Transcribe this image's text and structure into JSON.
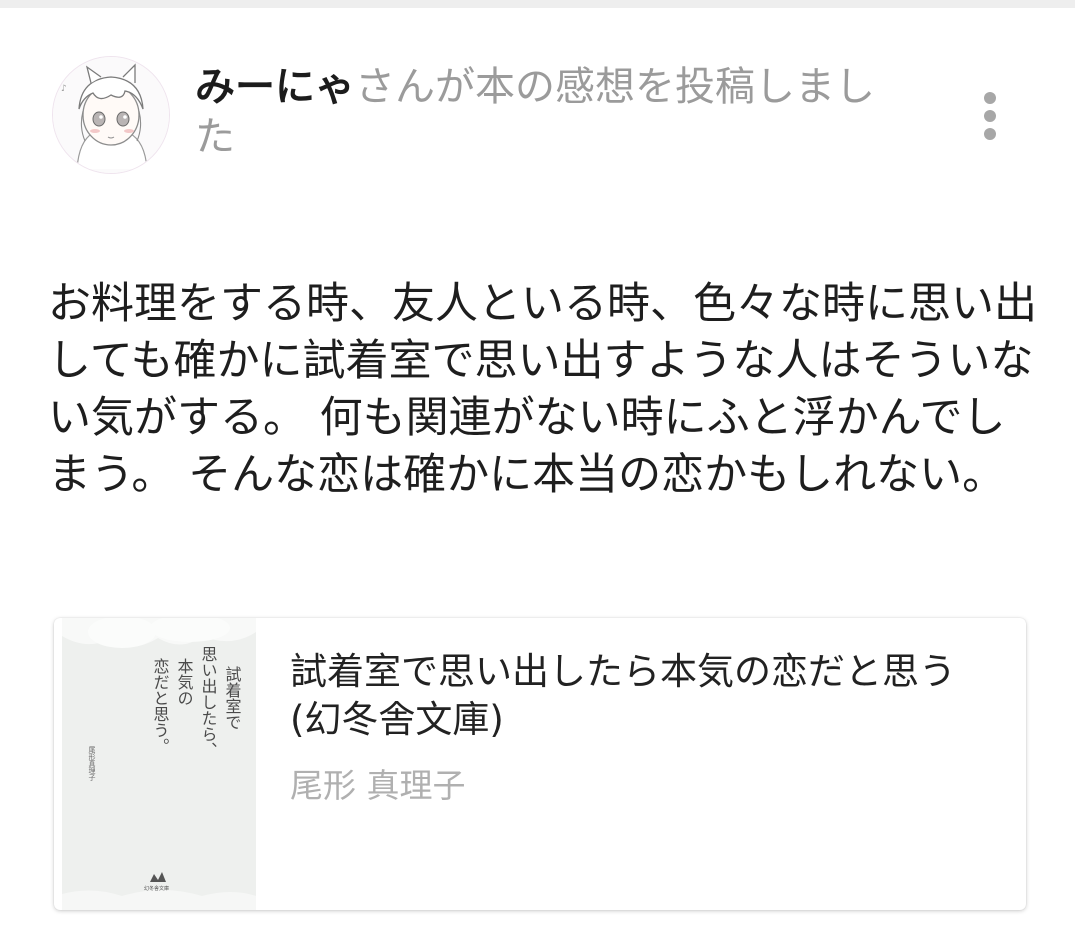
{
  "post": {
    "username": "みーにゃ",
    "action_text": "さんが本の感想を投稿しました",
    "more_icon": "more-vertical-icon"
  },
  "review": {
    "text": "お料理をする時、友人といる時、色々な時に思い出しても確かに試着室で思い出すような人はそういない気がする。 何も関連がない時にふと浮かんでしまう。 そんな恋は確かに本当の恋かもしれない。"
  },
  "book": {
    "title": "試着室で思い出したら本気の恋だと思う (幻冬舎文庫)",
    "author": "尾形 真理子",
    "cover_title_lines": [
      "試着室で",
      "思い出したら、",
      "本気の",
      "恋だと思う。"
    ],
    "cover_author": "尾形真理子",
    "cover_publisher": "幻冬舎文庫"
  },
  "colors": {
    "username": "#1c1c1c",
    "muted_text": "#9b9b9b",
    "author_text": "#b0b0b0",
    "body_text": "#1e1e1e"
  }
}
